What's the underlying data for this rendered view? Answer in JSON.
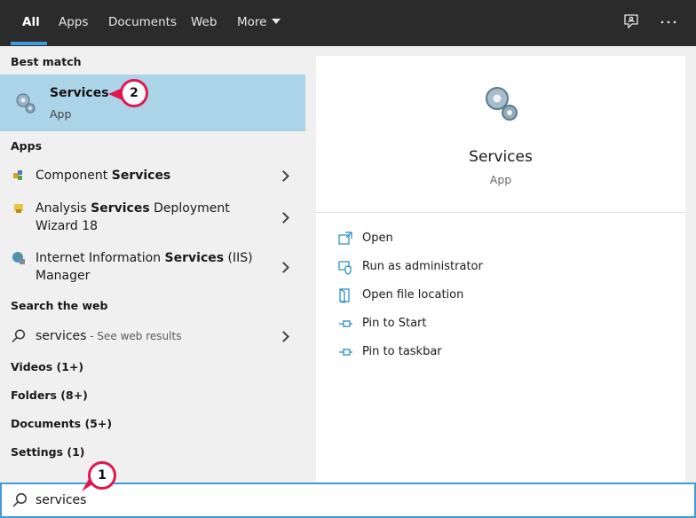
{
  "tabs": [
    {
      "label": "All"
    },
    {
      "label": "Apps"
    },
    {
      "label": "Documents"
    },
    {
      "label": "Web"
    },
    {
      "label": "More"
    }
  ],
  "accent_color": "#3f9ad9",
  "best_match": {
    "heading": "Best match",
    "title": "Services",
    "subtitle": "App"
  },
  "apps": {
    "heading": "Apps",
    "items": [
      {
        "pre": "Component ",
        "bold": "Services",
        "post": "",
        "line2": ""
      },
      {
        "pre": "Analysis ",
        "bold": "Services",
        "post": " Deployment",
        "line2": "Wizard 18"
      },
      {
        "pre": "Internet Information ",
        "bold": "Services",
        "post": " (IIS)",
        "line2": "Manager"
      }
    ]
  },
  "web": {
    "heading": "Search the web",
    "query": "services",
    "hint": " - See web results"
  },
  "categories": [
    {
      "label": "Videos (1+)"
    },
    {
      "label": "Folders (8+)"
    },
    {
      "label": "Documents (5+)"
    },
    {
      "label": "Settings (1)"
    }
  ],
  "search": {
    "value": "services"
  },
  "detail": {
    "title": "Services",
    "subtitle": "App",
    "actions": [
      {
        "label": "Open",
        "icon": "open-icon"
      },
      {
        "label": "Run as administrator",
        "icon": "shield-icon"
      },
      {
        "label": "Open file location",
        "icon": "folder-icon"
      },
      {
        "label": "Pin to Start",
        "icon": "pin-icon"
      },
      {
        "label": "Pin to taskbar",
        "icon": "pin-icon"
      }
    ]
  },
  "callouts": {
    "one": "1",
    "two": "2"
  }
}
